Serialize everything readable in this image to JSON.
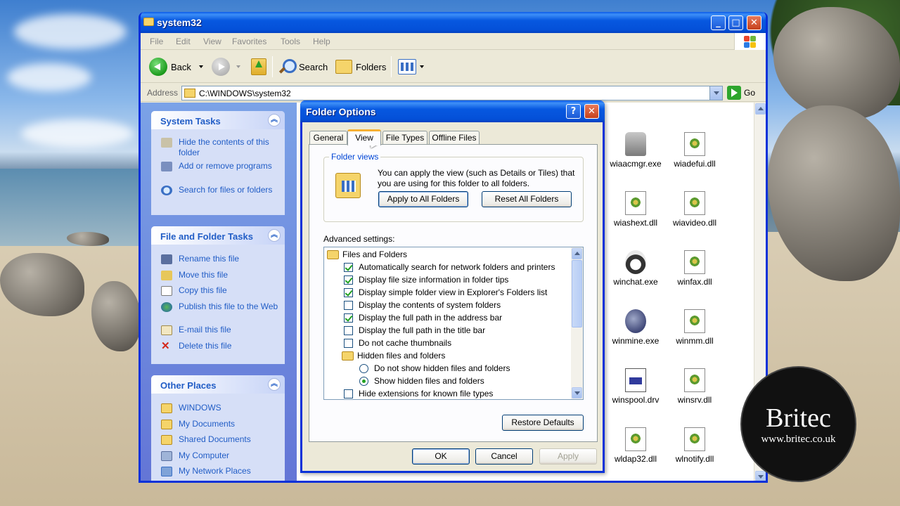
{
  "window": {
    "title": "system32",
    "controls": {
      "minimize": "_",
      "maximize": "□",
      "close": "✕"
    },
    "menus": [
      "File",
      "Edit",
      "View",
      "Favorites",
      "Tools",
      "Help"
    ]
  },
  "toolbar": {
    "back": "Back",
    "search": "Search",
    "folders": "Folders"
  },
  "address": {
    "label": "Address",
    "value": "C:\\WINDOWS\\system32",
    "go": "Go"
  },
  "taskpane": {
    "system_tasks": {
      "title": "System Tasks",
      "items": [
        "Hide the contents of this folder",
        "Add or remove programs",
        "Search for files or folders"
      ]
    },
    "file_folder_tasks": {
      "title": "File and Folder Tasks",
      "items": [
        "Rename this file",
        "Move this file",
        "Copy this file",
        "Publish this file to the Web",
        "E-mail this file",
        "Delete this file"
      ]
    },
    "other_places": {
      "title": "Other Places",
      "items": [
        "WINDOWS",
        "My Documents",
        "Shared Documents",
        "My Computer",
        "My Network Places"
      ]
    }
  },
  "files": [
    {
      "name": "wiaacmgr.exe",
      "icon": "scanner-icon"
    },
    {
      "name": "wiadefui.dll",
      "icon": "dll-icon"
    },
    {
      "name": "wiashext.dll",
      "icon": "dll-icon"
    },
    {
      "name": "wiavideo.dll",
      "icon": "dll-icon"
    },
    {
      "name": "winchat.exe",
      "icon": "phone-icon"
    },
    {
      "name": "winfax.dll",
      "icon": "dll-icon"
    },
    {
      "name": "winmine.exe",
      "icon": "mine-icon"
    },
    {
      "name": "winmm.dll",
      "icon": "dll-icon"
    },
    {
      "name": "winspool.drv",
      "icon": "driver-icon"
    },
    {
      "name": "winsrv.dll",
      "icon": "dll-icon"
    },
    {
      "name": "wldap32.dll",
      "icon": "dll-icon"
    },
    {
      "name": "wlnotify.dll",
      "icon": "dll-icon"
    }
  ],
  "dialog": {
    "title": "Folder Options",
    "help": "?",
    "close": "✕",
    "tabs": [
      "General",
      "View",
      "File Types",
      "Offline Files"
    ],
    "active_tab": "View",
    "folder_views": {
      "label": "Folder views",
      "text": "You can apply the view (such as Details or Tiles) that you are using for this folder to all folders.",
      "apply_all": "Apply to All Folders",
      "reset_all": "Reset All Folders"
    },
    "advanced_label": "Advanced settings:",
    "advanced": [
      {
        "type": "folder",
        "label": "Files and Folders",
        "level": 0
      },
      {
        "type": "check",
        "label": "Automatically search for network folders and printers",
        "checked": true,
        "level": 1
      },
      {
        "type": "check",
        "label": "Display file size information in folder tips",
        "checked": true,
        "level": 1
      },
      {
        "type": "check",
        "label": "Display simple folder view in Explorer's Folders list",
        "checked": true,
        "level": 1
      },
      {
        "type": "check",
        "label": "Display the contents of system folders",
        "checked": false,
        "level": 1
      },
      {
        "type": "check",
        "label": "Display the full path in the address bar",
        "checked": true,
        "level": 1
      },
      {
        "type": "check",
        "label": "Display the full path in the title bar",
        "checked": false,
        "level": 1
      },
      {
        "type": "check",
        "label": "Do not cache thumbnails",
        "checked": false,
        "level": 1
      },
      {
        "type": "folder",
        "label": "Hidden files and folders",
        "level": 1
      },
      {
        "type": "radio",
        "label": "Do not show hidden files and folders",
        "checked": false,
        "level": 2
      },
      {
        "type": "radio",
        "label": "Show hidden files and folders",
        "checked": true,
        "level": 2
      },
      {
        "type": "check",
        "label": "Hide extensions for known file types",
        "checked": false,
        "level": 1
      }
    ],
    "restore_defaults": "Restore Defaults",
    "ok": "OK",
    "cancel": "Cancel",
    "apply": "Apply"
  },
  "watermark": {
    "brand": "Britec",
    "url": "www.britec.co.uk"
  }
}
